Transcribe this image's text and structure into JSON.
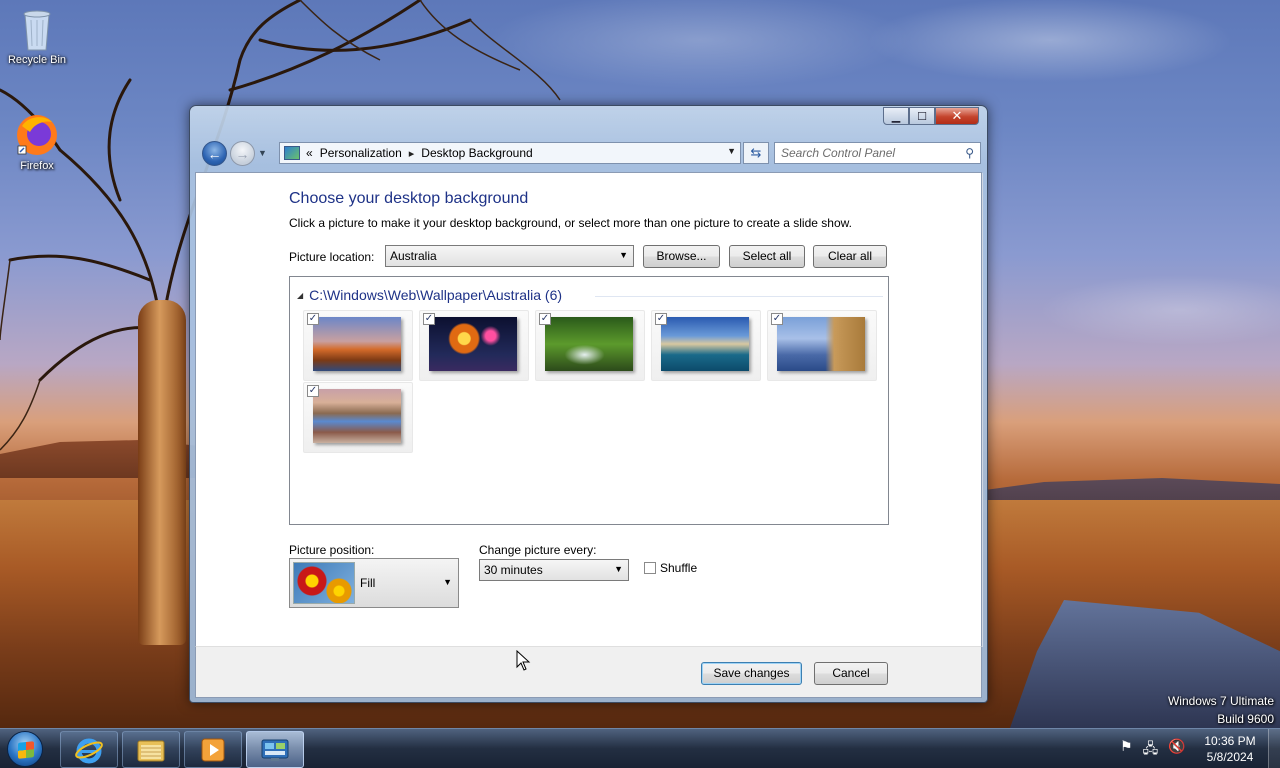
{
  "desktop": {
    "icons": [
      {
        "label": "Recycle Bin",
        "icon": "recycle-bin-icon"
      },
      {
        "label": "Firefox",
        "icon": "firefox-icon"
      }
    ],
    "os_line1": "Windows 7 Ultimate",
    "os_line2": "Build 9600"
  },
  "window": {
    "caption_buttons": {
      "minimize": "▁",
      "maximize": "☐",
      "close": "✕"
    },
    "address": {
      "prefix": "«",
      "crumbs": [
        "Personalization",
        "Desktop Background"
      ],
      "separator": "▸"
    },
    "search_placeholder": "Search Control Panel",
    "title": "Choose your desktop background",
    "description": "Click a picture to make it your desktop background, or select more than one picture to create a slide show.",
    "picture_location_label": "Picture location:",
    "picture_location_value": "Australia",
    "buttons": {
      "browse": "Browse...",
      "select_all": "Select all",
      "clear_all": "Clear all",
      "save": "Save changes",
      "cancel": "Cancel"
    },
    "group_header": "C:\\Windows\\Web\\Wallpaper\\Australia (6)",
    "thumbnails": [
      {
        "checked": true,
        "name": "outback-baobab"
      },
      {
        "checked": true,
        "name": "sydney-fireworks"
      },
      {
        "checked": true,
        "name": "rainforest-waterfall"
      },
      {
        "checked": true,
        "name": "sydney-harbour"
      },
      {
        "checked": true,
        "name": "twelve-apostles"
      },
      {
        "checked": true,
        "name": "kimberley-river"
      }
    ],
    "picture_position_label": "Picture position:",
    "picture_position_value": "Fill",
    "change_every_label": "Change picture every:",
    "change_every_value": "30 minutes",
    "shuffle_label": "Shuffle",
    "shuffle_checked": false
  },
  "taskbar": {
    "pinned": [
      "internet-explorer-icon",
      "windows-explorer-icon",
      "media-player-icon",
      "control-panel-icon"
    ],
    "time": "10:36 PM",
    "date": "5/8/2024"
  }
}
